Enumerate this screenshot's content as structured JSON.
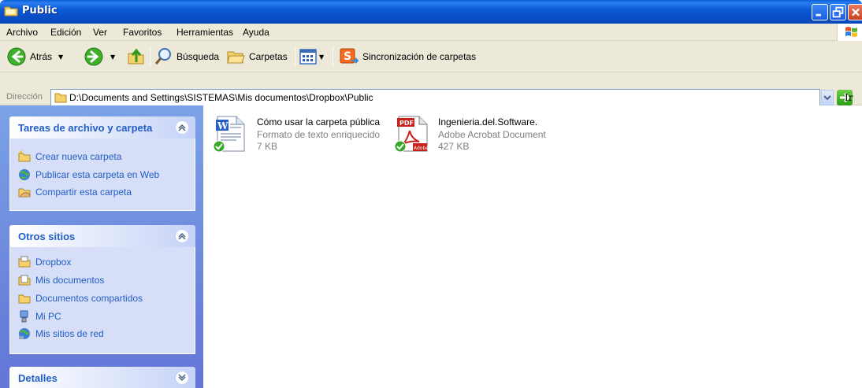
{
  "window": {
    "title": "Public",
    "accent": "#0a5fd8"
  },
  "menu": {
    "items": [
      "Archivo",
      "Edición",
      "Ver",
      "Favoritos",
      "Herramientas",
      "Ayuda"
    ]
  },
  "toolbar": {
    "back_label": "Atrás",
    "search_label": "Búsqueda",
    "folders_label": "Carpetas",
    "sync_label": "Sincronización de carpetas"
  },
  "address": {
    "label": "Dirección",
    "value": "D:\\Documents and Settings\\SISTEMAS\\Mis documentos\\Dropbox\\Public",
    "go_label": "Ir"
  },
  "taskpane": {
    "file_tasks": {
      "title": "Tareas de archivo y carpeta",
      "items": [
        {
          "label": "Crear nueva carpeta",
          "icon": "new-folder-icon"
        },
        {
          "label": "Publicar esta carpeta en Web",
          "icon": "web-publish-icon"
        },
        {
          "label": "Compartir esta carpeta",
          "icon": "share-folder-icon"
        }
      ]
    },
    "other_places": {
      "title": "Otros sitios",
      "items": [
        {
          "label": "Dropbox",
          "icon": "dropbox-folder-icon"
        },
        {
          "label": "Mis documentos",
          "icon": "my-documents-icon"
        },
        {
          "label": "Documentos compartidos",
          "icon": "shared-documents-icon"
        },
        {
          "label": "Mi PC",
          "icon": "my-computer-icon"
        },
        {
          "label": "Mis sitios de red",
          "icon": "network-places-icon"
        }
      ]
    },
    "details": {
      "title": "Detalles"
    }
  },
  "files": [
    {
      "name": "Cómo usar la carpeta pública",
      "type": "Formato de texto enriquecido",
      "size": "7 KB",
      "icon": "word-document-icon"
    },
    {
      "name": "Ingenieria.del.Software.",
      "type": "Adobe Acrobat Document",
      "size": "427 KB",
      "icon": "pdf-document-icon",
      "badge": "PDF",
      "brand": "Adobe"
    }
  ]
}
